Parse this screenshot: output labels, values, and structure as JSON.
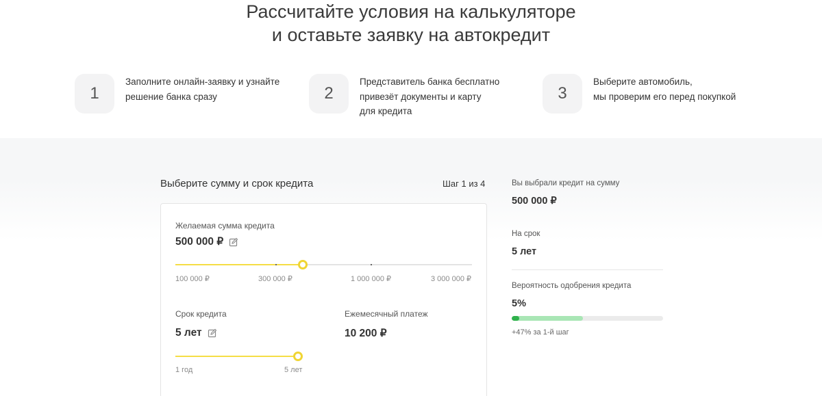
{
  "hero": {
    "title_line1": "Рассчитайте условия на калькуляторе",
    "title_line2": "и оставьте заявку на автокредит"
  },
  "steps": [
    {
      "number": "1",
      "text": "Заполните онлайн-заявку и узнайте\nрешение банка сразу"
    },
    {
      "number": "2",
      "text": "Представитель банка бесплатно\nпривезёт документы и карту\nдля кредита"
    },
    {
      "number": "3",
      "text": "Выберите автомобиль,\nмы проверим его перед покупкой"
    }
  ],
  "calculator": {
    "title": "Выберите сумму и срок кредита",
    "step_indicator": "Шаг 1 из 4",
    "amount": {
      "label": "Желаемая сумма кредита",
      "value": "500 000 ₽",
      "slider_fraction": 0.43,
      "ticks": [
        "100 000 ₽",
        "300 000 ₽",
        "1 000 000 ₽",
        "3 000 000 ₽"
      ]
    },
    "term": {
      "label": "Срок кредита",
      "value": "5 лет",
      "slider_fraction": 1.0,
      "ticks": [
        "1 год",
        "5 лет"
      ]
    },
    "payment": {
      "label": "Ежемесячный платеж",
      "value": "10 200 ₽"
    }
  },
  "summary": {
    "amount_label": "Вы выбрали кредит на сумму",
    "amount_value": "500 000 ₽",
    "term_label": "На срок",
    "term_value": "5 лет",
    "probability_label": "Вероятность одобрения кредита",
    "probability_value": "5%",
    "probability_fraction": 0.05,
    "probability_potential_fraction": 0.47,
    "probability_note": "+47% за 1-й шаг"
  },
  "colors": {
    "slider_accent": "#f5dd45",
    "probability_green": "#2fb14c",
    "probability_light": "#a9e6b5"
  },
  "icons": {
    "edit": "pencil-square-icon"
  }
}
